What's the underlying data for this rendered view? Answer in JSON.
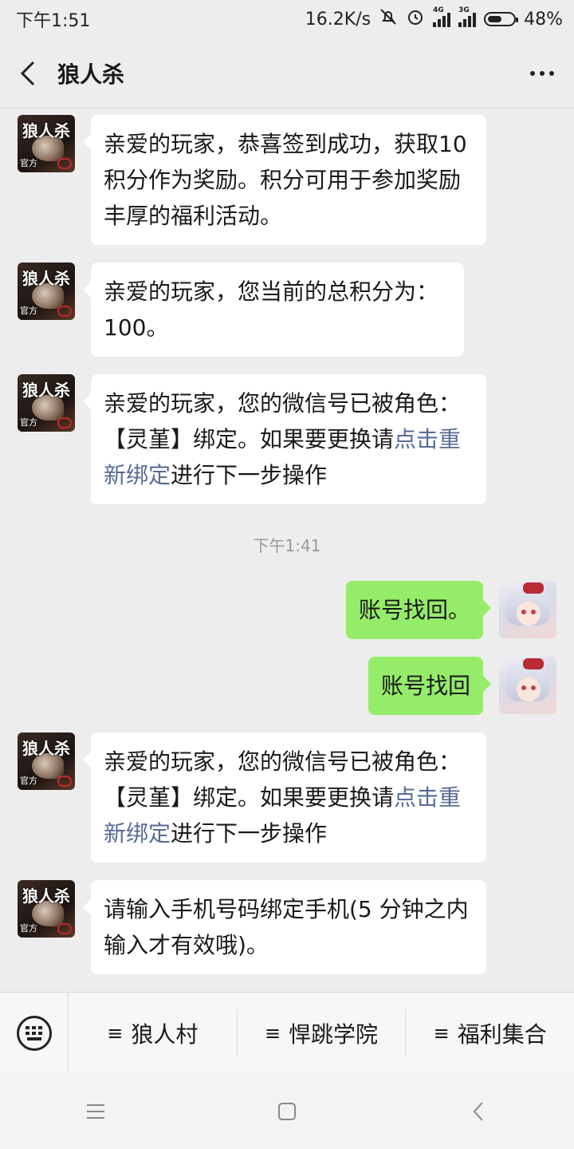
{
  "status_bar": {
    "time": "下午1:51",
    "network_speed": "16.2K/s",
    "sim1_label": "4G",
    "sim2_label": "3G",
    "battery": "48%",
    "icons": [
      "mute-bell-icon",
      "alarm-icon",
      "signal-icon",
      "signal-icon",
      "battery-icon"
    ]
  },
  "header": {
    "title": "狼人杀"
  },
  "avatar_official": {
    "title": "狼人杀",
    "sub": "官方"
  },
  "messages": [
    {
      "side": "left",
      "text": "亲爱的玩家，恭喜签到成功，获取10 积分作为奖励。积分可用于参加奖励丰厚的福利活动。"
    },
    {
      "side": "left",
      "text": "亲爱的玩家，您当前的总积分为：100。"
    },
    {
      "side": "left",
      "text_before": "亲爱的玩家，您的微信号已被角色：【灵堇】绑定。如果要更换请",
      "link": "点击重新绑定",
      "text_after": "进行下一步操作"
    },
    {
      "side": "right",
      "text": "账号找回。"
    },
    {
      "side": "right",
      "text": "账号找回"
    },
    {
      "side": "left",
      "text_before": "亲爱的玩家，您的微信号已被角色：【灵堇】绑定。如果要更换请",
      "link": "点击重新绑定",
      "text_after": "进行下一步操作"
    },
    {
      "side": "left",
      "text": "请输入手机号码绑定手机(5 分钟之内输入才有效哦)。"
    }
  ],
  "timestamp": "下午1:41",
  "menu": {
    "items": [
      {
        "icon": "≡",
        "label": "狼人村"
      },
      {
        "icon": "≡",
        "label": "悍跳学院"
      },
      {
        "icon": "≡",
        "label": "福利集合"
      }
    ]
  },
  "colors": {
    "chat_bg": "#ededed",
    "bubble_white": "#ffffff",
    "bubble_green": "#95ec69",
    "link": "#576b95",
    "timestamp": "#999999"
  }
}
